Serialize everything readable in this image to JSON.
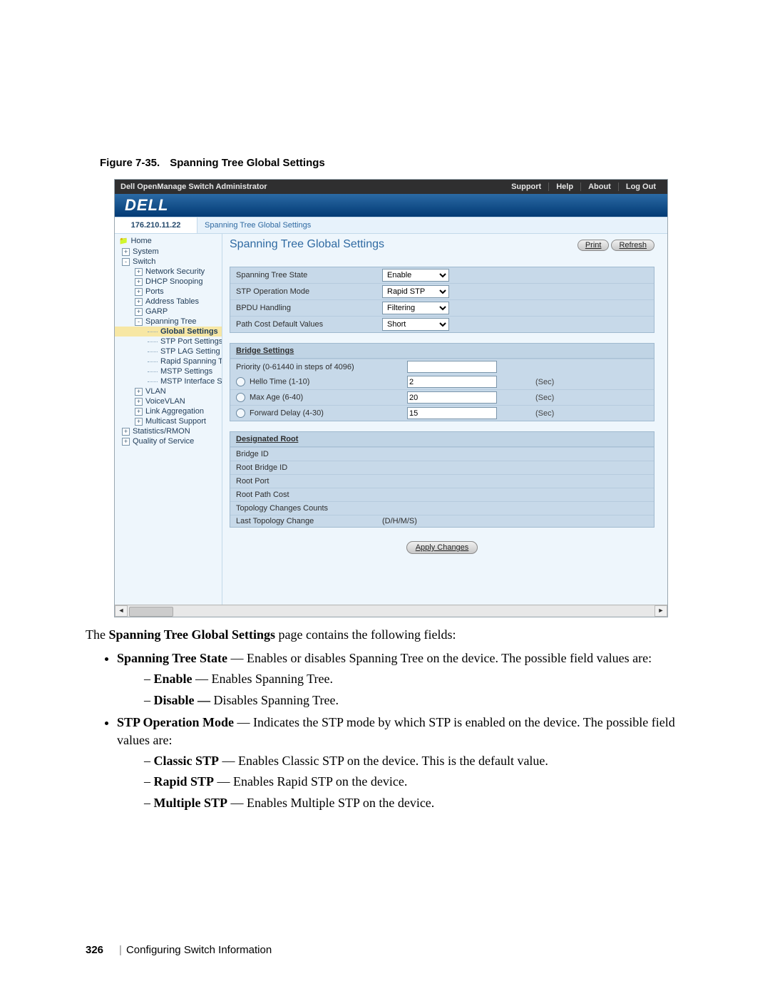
{
  "figure": {
    "number": "Figure 7-35.",
    "title": "Spanning Tree Global Settings"
  },
  "topbar": {
    "app_title": "Dell OpenManage Switch Administrator",
    "links": [
      "Support",
      "Help",
      "About",
      "Log Out"
    ]
  },
  "logo": "DELL",
  "ip": "176.210.11.22",
  "breadcrumb": "Spanning Tree Global Settings",
  "nav": {
    "home": "Home",
    "items": [
      {
        "l": 1,
        "box": "+",
        "label": "System"
      },
      {
        "l": 1,
        "box": "-",
        "label": "Switch"
      },
      {
        "l": 2,
        "box": "+",
        "label": "Network Security"
      },
      {
        "l": 2,
        "box": "+",
        "label": "DHCP Snooping"
      },
      {
        "l": 2,
        "box": "+",
        "label": "Ports"
      },
      {
        "l": 2,
        "box": "+",
        "label": "Address Tables"
      },
      {
        "l": 2,
        "box": "+",
        "label": "GARP"
      },
      {
        "l": 2,
        "box": "-",
        "label": "Spanning Tree"
      },
      {
        "l": 3,
        "box": "",
        "label": "Global Settings",
        "selected": true
      },
      {
        "l": 3,
        "box": "",
        "label": "STP Port Settings"
      },
      {
        "l": 3,
        "box": "",
        "label": "STP LAG Setting"
      },
      {
        "l": 3,
        "box": "",
        "label": "Rapid Spanning T"
      },
      {
        "l": 3,
        "box": "",
        "label": "MSTP Settings"
      },
      {
        "l": 3,
        "box": "",
        "label": "MSTP Interface S"
      },
      {
        "l": 2,
        "box": "+",
        "label": "VLAN"
      },
      {
        "l": 2,
        "box": "+",
        "label": "VoiceVLAN"
      },
      {
        "l": 2,
        "box": "+",
        "label": "Link Aggregation"
      },
      {
        "l": 2,
        "box": "+",
        "label": "Multicast Support"
      },
      {
        "l": 1,
        "box": "+",
        "label": "Statistics/RMON"
      },
      {
        "l": 1,
        "box": "+",
        "label": "Quality of Service"
      }
    ]
  },
  "content": {
    "title": "Spanning Tree Global Settings",
    "print": "Print",
    "refresh": "Refresh",
    "section1": {
      "rows": [
        {
          "label": "Spanning Tree State",
          "value": "Enable"
        },
        {
          "label": "STP Operation Mode",
          "value": "Rapid STP"
        },
        {
          "label": "BPDU Handling",
          "value": "Filtering"
        },
        {
          "label": "Path Cost Default Values",
          "value": "Short"
        }
      ]
    },
    "bridge": {
      "header": "Bridge Settings",
      "priority_label": "Priority (0-61440 in steps of 4096)",
      "priority_value": "",
      "rows": [
        {
          "label": "Hello Time (1-10)",
          "value": "2",
          "unit": "(Sec)"
        },
        {
          "label": "Max Age (6-40)",
          "value": "20",
          "unit": "(Sec)"
        },
        {
          "label": "Forward Delay (4-30)",
          "value": "15",
          "unit": "(Sec)"
        }
      ]
    },
    "root": {
      "header": "Designated Root",
      "rows": [
        "Bridge ID",
        "Root Bridge ID",
        "Root Port",
        "Root Path Cost",
        "Topology Changes Counts"
      ],
      "last_change_label": "Last Topology Change",
      "last_change_value": "(D/H/M/S)"
    },
    "apply": "Apply Changes"
  },
  "body": {
    "intro_pre": "The ",
    "intro_bold": "Spanning Tree Global Settings",
    "intro_post": " page contains the following fields:",
    "b1_bold": "Spanning Tree State",
    "b1_rest": " — Enables or disables Spanning Tree on the device. The possible field values are:",
    "b1a_bold": "Enable",
    "b1a_rest": " — Enables Spanning Tree.",
    "b1b_bold": "Disable —",
    "b1b_rest": " Disables Spanning Tree.",
    "b2_bold": "STP Operation Mode",
    "b2_rest": " — Indicates the STP mode by which STP is enabled on the device. The possible field values are:",
    "b2a_bold": "Classic STP",
    "b2a_rest": " — Enables Classic STP on the device. This is the default value.",
    "b2b_bold": "Rapid STP",
    "b2b_rest": " — Enables Rapid STP on the device.",
    "b2c_bold": "Multiple STP",
    "b2c_rest": " — Enables Multiple STP on the device."
  },
  "footer": {
    "page": "326",
    "chapter": "Configuring Switch Information"
  }
}
